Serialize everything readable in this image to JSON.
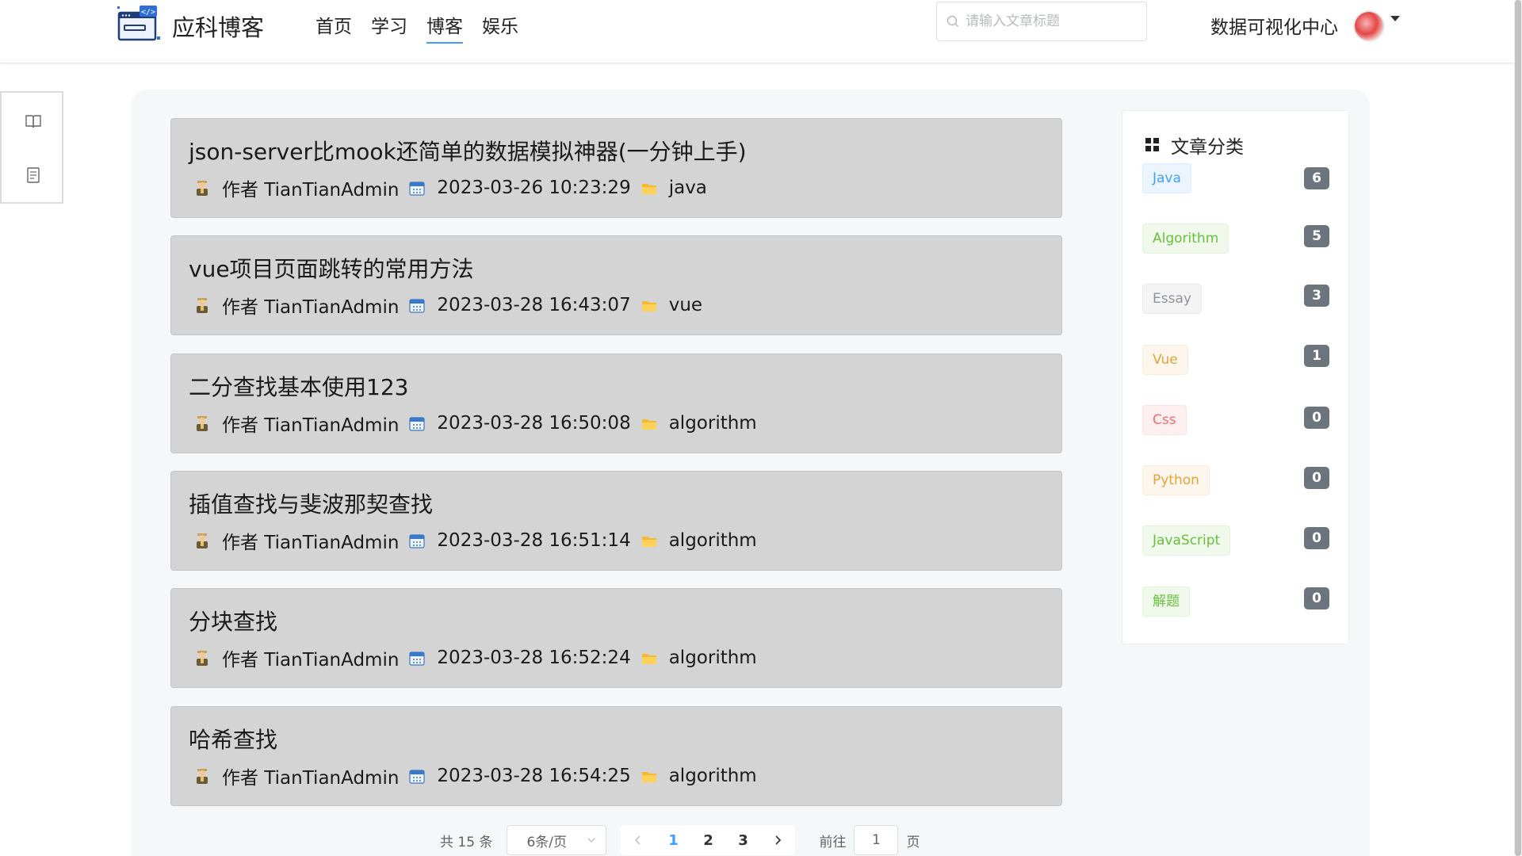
{
  "header": {
    "brand": "应科博客",
    "nav": [
      {
        "label": "首页",
        "active": false
      },
      {
        "label": "学习",
        "active": false
      },
      {
        "label": "博客",
        "active": true
      },
      {
        "label": "娱乐",
        "active": false
      }
    ],
    "search_placeholder": "请输入文章标题",
    "viz_link": "数据可视化中心",
    "accent_color": "#409eff"
  },
  "sidebar": {
    "icons": [
      "book-open-icon",
      "document-icon"
    ]
  },
  "articles": [
    {
      "title": "json-server比mook还简单的数据模拟神器(一分钟上手)",
      "author": "作者 TianTianAdmin",
      "date": "2023-03-26 10:23:29",
      "category": "java"
    },
    {
      "title": "vue项目页面跳转的常用方法",
      "author": "作者 TianTianAdmin",
      "date": "2023-03-28 16:43:07",
      "category": "vue"
    },
    {
      "title": "二分查找基本使用123",
      "author": "作者 TianTianAdmin",
      "date": "2023-03-28 16:50:08",
      "category": "algorithm"
    },
    {
      "title": "插值查找与斐波那契查找",
      "author": "作者 TianTianAdmin",
      "date": "2023-03-28 16:51:14",
      "category": "algorithm"
    },
    {
      "title": "分块查找",
      "author": "作者 TianTianAdmin",
      "date": "2023-03-28 16:52:24",
      "category": "algorithm"
    },
    {
      "title": "哈希查找",
      "author": "作者 TianTianAdmin",
      "date": "2023-03-28 16:54:25",
      "category": "algorithm"
    }
  ],
  "pagination": {
    "total": "共 15 条",
    "page_size": "6条/页",
    "pages": [
      "1",
      "2",
      "3"
    ],
    "current": "1",
    "jump_prefix": "前往",
    "jump_value": "1",
    "jump_suffix": "页"
  },
  "categories": {
    "title": "文章分类",
    "items": [
      {
        "name": "Java",
        "count": "6",
        "color": "#409eff",
        "bg": "#ecf5ff",
        "border": "#d9ecff"
      },
      {
        "name": "Algorithm",
        "count": "5",
        "color": "#67c23a",
        "bg": "#f0f9eb",
        "border": "#e1f3d8"
      },
      {
        "name": "Essay",
        "count": "3",
        "color": "#909399",
        "bg": "#f4f4f5",
        "border": "#e9e9eb"
      },
      {
        "name": "Vue",
        "count": "1",
        "color": "#e6a23c",
        "bg": "#fdf6ec",
        "border": "#faecd8"
      },
      {
        "name": "Css",
        "count": "0",
        "color": "#f56c6c",
        "bg": "#fef0f0",
        "border": "#fde2e2"
      },
      {
        "name": "Python",
        "count": "0",
        "color": "#e6a23c",
        "bg": "#fdf6ec",
        "border": "#faecd8"
      },
      {
        "name": "JavaScript",
        "count": "0",
        "color": "#67c23a",
        "bg": "#f0f9eb",
        "border": "#e1f3d8"
      },
      {
        "name": "解题",
        "count": "0",
        "color": "#67c23a",
        "bg": "#f0f9eb",
        "border": "#e1f3d8"
      }
    ]
  }
}
